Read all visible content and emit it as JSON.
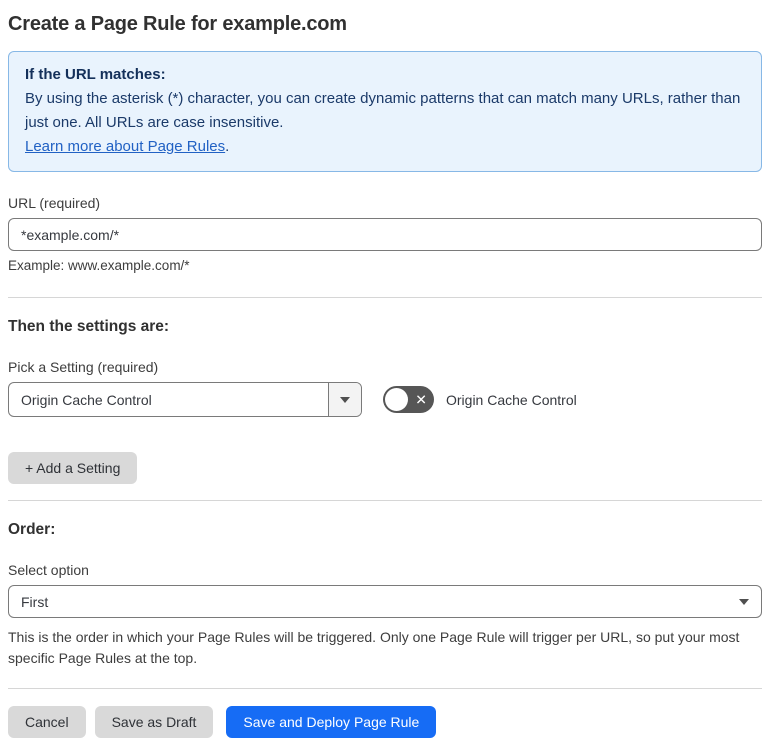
{
  "page": {
    "title": "Create a Page Rule for example.com"
  },
  "info_box": {
    "heading": "If the URL matches:",
    "body": "By using the asterisk (*) character, you can create dynamic patterns that can match many URLs, rather than just one. All URLs are case insensitive.",
    "link_label": "Learn more about Page Rules",
    "link_suffix": "."
  },
  "url_field": {
    "label": "URL (required)",
    "value": "*example.com/*",
    "help": "Example: www.example.com/*"
  },
  "settings_section": {
    "heading": "Then the settings are:",
    "picker_label": "Pick a Setting (required)",
    "picker_value": "Origin Cache Control",
    "toggle_label": "Origin Cache Control",
    "toggle_state": "off",
    "toggle_glyph": "✕",
    "add_setting_label": "+ Add a Setting"
  },
  "order_section": {
    "heading": "Order:",
    "select_label": "Select option",
    "select_value": "First",
    "help": "This is the order in which your Page Rules will be triggered. Only one Page Rule will trigger per URL, so put your most specific Page Rules at the top."
  },
  "footer": {
    "cancel_label": "Cancel",
    "save_draft_label": "Save as Draft",
    "save_deploy_label": "Save and Deploy Page Rule"
  },
  "colors": {
    "primary_blue": "#166cf5",
    "info_bg": "#e9f3fd",
    "info_border": "#87b8e6",
    "info_text": "#16325c",
    "link_blue": "#2161c4",
    "gray_button_bg": "#d9d9d9",
    "toggle_off_bg": "#565656"
  }
}
